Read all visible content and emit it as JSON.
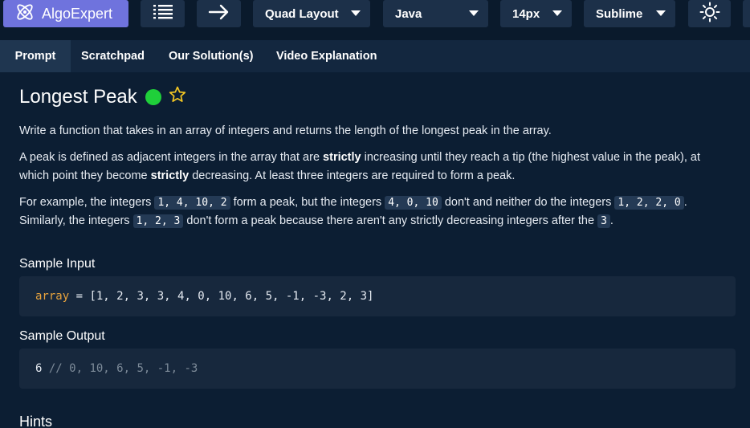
{
  "toolbar": {
    "brand": "AlgoExpert",
    "layout_label": "Quad Layout",
    "language_label": "Java",
    "font_size_label": "14px",
    "theme_label": "Sublime",
    "icons": [
      "algoexpert-logo-icon",
      "list-icon",
      "arrow-right-icon",
      "caret-down-icon",
      "sun-icon"
    ],
    "colors": {
      "brand_bg": "#6f73dd",
      "button_bg": "#1c3049"
    }
  },
  "tabs": [
    {
      "label": "Prompt",
      "active": true
    },
    {
      "label": "Scratchpad",
      "active": false
    },
    {
      "label": "Our Solution(s)",
      "active": false
    },
    {
      "label": "Video Explanation",
      "active": false
    }
  ],
  "prompt": {
    "title": "Longest Peak",
    "status_color": "#1fcf3a",
    "p1": "Write a function that takes in an array of integers and returns the length of the longest peak in the array.",
    "p2": {
      "a": "A peak is defined as adjacent integers in the array that are ",
      "b": "strictly",
      "c": " increasing until they reach a tip (the highest value in the peak), at which point they become ",
      "d": "strictly",
      "e": " decreasing. At least three integers are required to form a peak."
    },
    "p3": {
      "a": "For example, the integers ",
      "code1": "1, 4, 10, 2",
      "b": " form a peak, but the integers ",
      "code2": "4, 0, 10",
      "c": " don't and neither do the integers ",
      "code3": "1, 2, 2, 0",
      "d": ". Similarly, the integers ",
      "code4": "1, 2, 3",
      "e": " don't form a peak because there aren't any strictly decreasing integers after the ",
      "code5": "3",
      "f": "."
    },
    "sample_input_title": "Sample Input",
    "sample_input": {
      "var": "array",
      "rest": " = [1, 2, 3, 3, 4, 0, 10, 6, 5, -1, -3, 2, 3]"
    },
    "sample_output_title": "Sample Output",
    "sample_output": {
      "value": "6",
      "comment": " // 0, 10, 6, 5, -1, -3"
    },
    "hints_title": "Hints"
  }
}
